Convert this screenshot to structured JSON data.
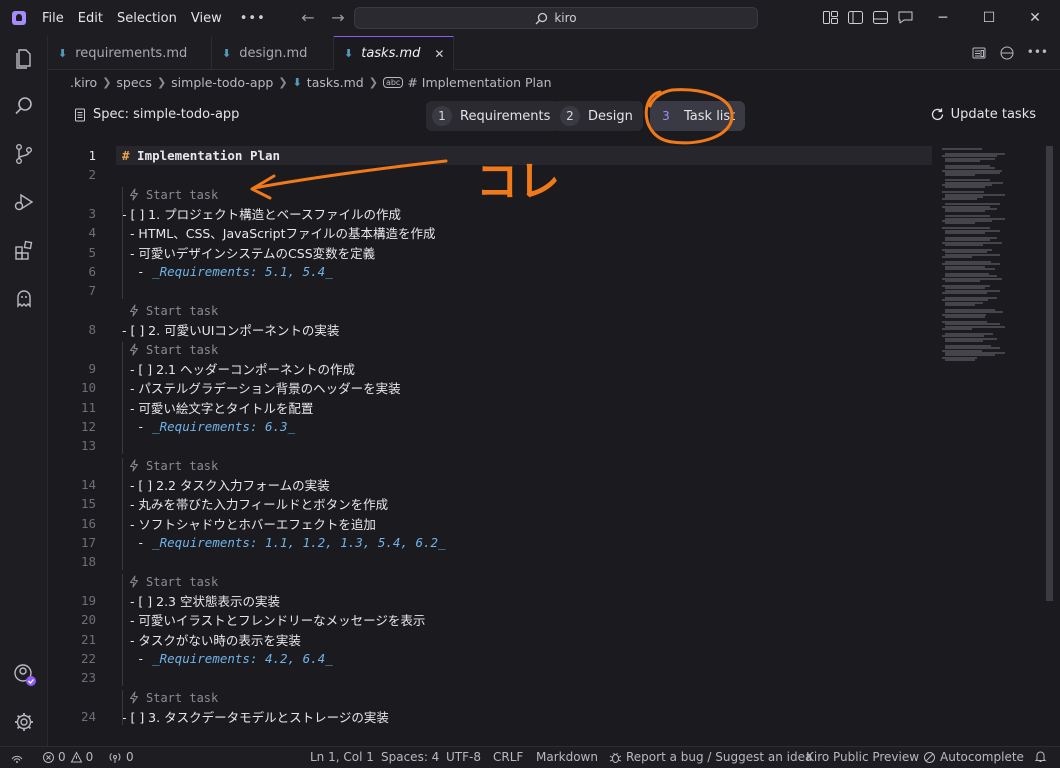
{
  "titlebar": {
    "menu": [
      "File",
      "Edit",
      "Selection",
      "View"
    ],
    "more": "•••",
    "search_text": "kiro"
  },
  "tabs": [
    {
      "label": "requirements.md",
      "active": false
    },
    {
      "label": "design.md",
      "active": false
    },
    {
      "label": "tasks.md",
      "active": true
    }
  ],
  "tab_close": "✕",
  "breadcrumb": {
    "parts": [
      ".kiro",
      "specs",
      "simple-todo-app",
      "tasks.md"
    ],
    "symbol": "# Implementation Plan"
  },
  "spec": {
    "label": "Spec: simple-todo-app",
    "steps": [
      {
        "num": "1",
        "label": "Requirements"
      },
      {
        "num": "2",
        "label": "Design"
      },
      {
        "num": "3",
        "label": "Task list"
      }
    ],
    "update": "Update tasks"
  },
  "editor": {
    "codelens": "Start task",
    "heading_hash": "#",
    "heading_text": " Implementation Plan",
    "lines": [
      {
        "n": "1"
      },
      {
        "n": "2"
      },
      {
        "n": "3",
        "text": "- [ ] 1. プロジェクト構造とベースファイルの作成"
      },
      {
        "n": "4",
        "text": "  - HTML、CSS、JavaScriptファイルの基本構造を作成"
      },
      {
        "n": "5",
        "text": "  - 可愛いデザインシステムのCSS変数を定義"
      },
      {
        "n": "6",
        "dash": "  - ",
        "req": "_Requirements: 5.1, 5.4_"
      },
      {
        "n": "7"
      },
      {
        "n": "8",
        "text": "- [ ] 2. 可愛いUIコンポーネントの実装"
      },
      {
        "n": "9",
        "text": "  - [ ] 2.1 ヘッダーコンポーネントの作成"
      },
      {
        "n": "10",
        "text": "  - パステルグラデーション背景のヘッダーを実装"
      },
      {
        "n": "11",
        "text": "  - 可愛い絵文字とタイトルを配置"
      },
      {
        "n": "12",
        "dash": "  - ",
        "req": "_Requirements: 6.3_"
      },
      {
        "n": "13"
      },
      {
        "n": "14",
        "text": "  - [ ] 2.2 タスク入力フォームの実装"
      },
      {
        "n": "15",
        "text": "  - 丸みを帯びた入力フィールドとボタンを作成"
      },
      {
        "n": "16",
        "text": "  - ソフトシャドウとホバーエフェクトを追加"
      },
      {
        "n": "17",
        "dash": "  - ",
        "req": "_Requirements: 1.1, 1.2, 1.3, 5.4, 6.2_"
      },
      {
        "n": "18"
      },
      {
        "n": "19",
        "text": "  - [ ] 2.3 空状態表示の実装"
      },
      {
        "n": "20",
        "text": "  - 可愛いイラストとフレンドリーなメッセージを表示"
      },
      {
        "n": "21",
        "text": "  - タスクがない時の表示を実装"
      },
      {
        "n": "22",
        "dash": "  - ",
        "req": "_Requirements: 4.2, 6.4_"
      },
      {
        "n": "23"
      },
      {
        "n": "24",
        "text": "- [ ] 3. タスクデータモデルとストレージの実装"
      }
    ]
  },
  "annotation_text": "コレ",
  "status": {
    "errors": "0",
    "warnings": "0",
    "ports": "0",
    "position": "Ln 1, Col 1",
    "spaces": "Spaces: 4",
    "encoding": "UTF-8",
    "eol": "CRLF",
    "language": "Markdown",
    "report": "Report a bug / Suggest an idea",
    "preview": "Kiro Public Preview",
    "autocomplete": "Autocomplete"
  },
  "colors": {
    "accent": "#8b5cf6",
    "requirements": "#6fb3e8",
    "heading_hash": "#e8a24a",
    "annotation": "#f07a1a"
  }
}
